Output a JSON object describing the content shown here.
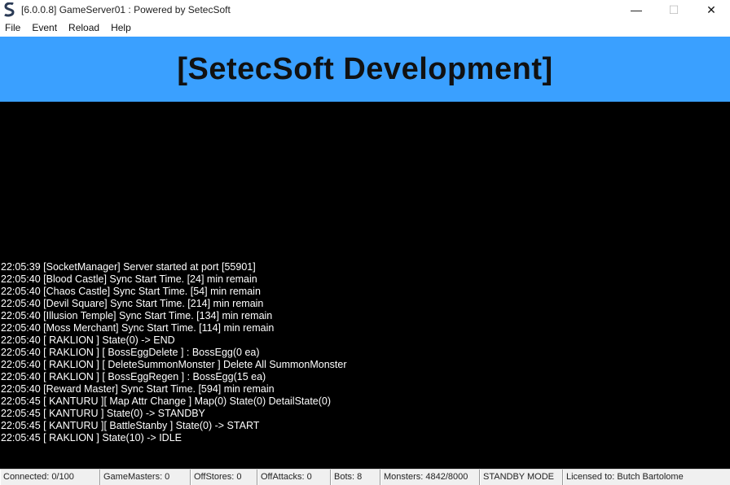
{
  "window": {
    "title": "[6.0.0.8] GameServer01 : Powered by SetecSoft",
    "minimize_glyph": "—",
    "maximize_glyph": "☐",
    "close_glyph": "✕"
  },
  "menu": [
    "File",
    "Event",
    "Reload",
    "Help"
  ],
  "banner": {
    "title": "[SetecSoft Development]",
    "background": "#3aa0ff"
  },
  "console": {
    "lines": [
      "22:05:39 [SocketManager] Server started at port [55901]",
      "22:05:40 [Blood Castle] Sync Start Time. [24] min remain",
      "22:05:40 [Chaos Castle] Sync Start Time. [54] min remain",
      "22:05:40 [Devil Square] Sync Start Time. [214] min remain",
      "22:05:40 [Illusion Temple] Sync Start Time. [134] min remain",
      "22:05:40 [Moss Merchant] Sync Start Time. [114] min remain",
      "22:05:40 [ RAKLION ] State(0) -> END",
      "22:05:40 [ RAKLION ] [ BossEggDelete ] : BossEgg(0 ea)",
      "22:05:40 [ RAKLION ] [ DeleteSummonMonster ] Delete All SummonMonster",
      "22:05:40 [ RAKLION ] [ BossEggRegen ] : BossEgg(15 ea)",
      "22:05:40 [Reward Master] Sync Start Time. [594] min remain",
      "22:05:45 [ KANTURU ][ Map Attr Change ] Map(0) State(0) DetailState(0)",
      "22:05:45 [ KANTURU ] State(0) -> STANDBY",
      "22:05:45 [ KANTURU ][ BattleStanby ] State(0) -> START",
      "22:05:45 [ RAKLION ] State(10) -> IDLE"
    ]
  },
  "status": {
    "connected": "Connected: 0/100",
    "gamemasters": "GameMasters: 0",
    "offstores": "OffStores: 0",
    "offattacks": "OffAttacks: 0",
    "bots": "Bots: 8",
    "monsters": "Monsters: 4842/8000",
    "mode": "STANDBY MODE",
    "license": "Licensed to: Butch Bartolome"
  }
}
